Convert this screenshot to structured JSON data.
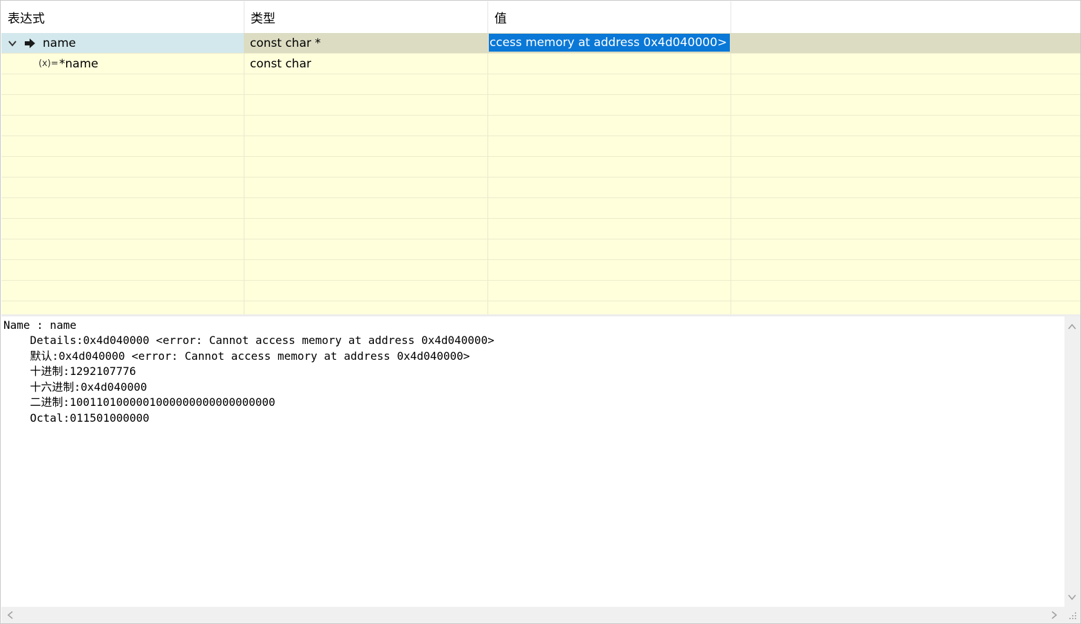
{
  "watch": {
    "columns": [
      "表达式",
      "类型",
      "值"
    ],
    "rows": [
      {
        "name": "name",
        "type": "const char *",
        "value": "ccess memory at address 0x4d040000>"
      },
      {
        "name": "*name",
        "type": "const char",
        "value": ""
      }
    ],
    "icons": {
      "expand": "chevron-down-icon",
      "current": "arrow-right-icon",
      "variable": "variable-icon"
    },
    "variable_icon_text": "(x)="
  },
  "details": {
    "lines": [
      "Name : name",
      "    Details:0x4d040000 <error: Cannot access memory at address 0x4d040000>",
      "    默认:0x4d040000 <error: Cannot access memory at address 0x4d040000>",
      "    十进制:1292107776",
      "    十六进制:0x4d040000",
      "    二进制:1001101000001000000000000000000",
      "    Octal:011501000000"
    ]
  },
  "colors": {
    "table_bg": "#ffffdc",
    "selected_row": "#dcdcc3",
    "selected_name": "#d3e8ec",
    "value_highlight": "#0a78d7"
  }
}
